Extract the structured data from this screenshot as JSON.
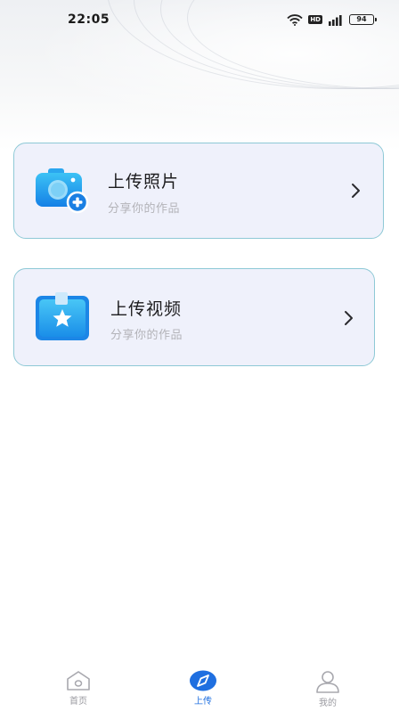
{
  "status_bar": {
    "time": "22:05",
    "hd_label": "HD",
    "battery": "94",
    "icons": [
      "wifi-icon",
      "hd-icon",
      "signal-icon",
      "battery-icon"
    ]
  },
  "cards": [
    {
      "title": "上传照片",
      "subtitle": "分享你的作品",
      "icon": "camera-add-icon"
    },
    {
      "title": "上传视频",
      "subtitle": "分享你的作品",
      "icon": "star-box-icon"
    }
  ],
  "tab_bar": {
    "items": [
      {
        "label": "首页",
        "icon": "home-icon",
        "active": false
      },
      {
        "label": "上传",
        "icon": "compass-icon",
        "active": true
      },
      {
        "label": "我的",
        "icon": "user-icon",
        "active": false
      }
    ]
  },
  "colors": {
    "card_bg": "#eff1fb",
    "card_border": "#8ec9d6",
    "accent": "#1f6fe0",
    "icon_blue": "#1aa6f0",
    "subtitle": "#b3b3b8"
  }
}
